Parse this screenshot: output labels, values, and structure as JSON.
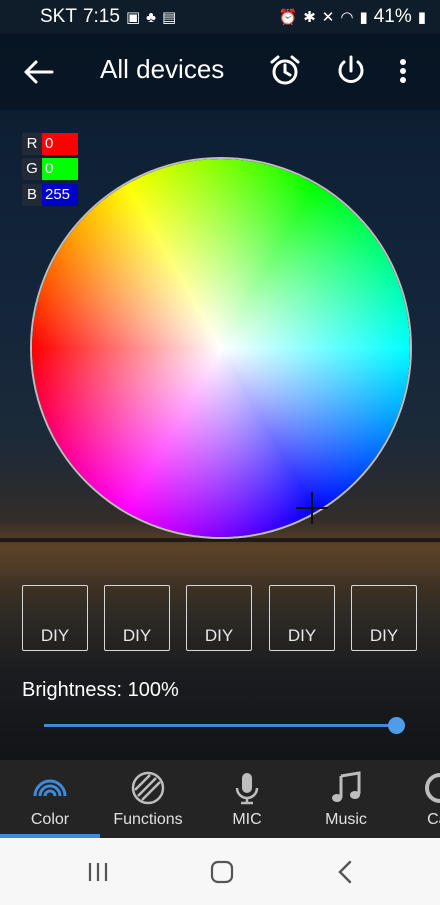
{
  "status_bar": {
    "carrier": "SKT",
    "time": "7:15",
    "battery": "41%"
  },
  "header": {
    "title": "All devices",
    "icons": [
      "back-arrow-icon",
      "alarm-clock-icon",
      "power-icon",
      "more-vert-icon"
    ]
  },
  "rgb": {
    "r_label": "R",
    "r_value": "0",
    "g_label": "G",
    "g_value": "0",
    "b_label": "B",
    "b_value": "255"
  },
  "colors": {
    "accent": "#3d8bd9",
    "r_badge": "#ff0000",
    "g_badge": "#00ff00",
    "b_badge": "#0000cc"
  },
  "diy_buttons": [
    "DIY",
    "DIY",
    "DIY",
    "DIY",
    "DIY"
  ],
  "brightness": {
    "label": "Brightness: 100%",
    "value": 100
  },
  "tabs": [
    {
      "label": "Color",
      "icon": "rainbow-icon",
      "active": true
    },
    {
      "label": "Functions",
      "icon": "functions-icon",
      "active": false
    },
    {
      "label": "MIC",
      "icon": "microphone-icon",
      "active": false
    },
    {
      "label": "Music",
      "icon": "music-note-icon",
      "active": false
    },
    {
      "label": "Car",
      "icon": "camera-icon",
      "active": false
    }
  ],
  "nav": [
    "recents-icon",
    "home-icon",
    "back-icon"
  ]
}
